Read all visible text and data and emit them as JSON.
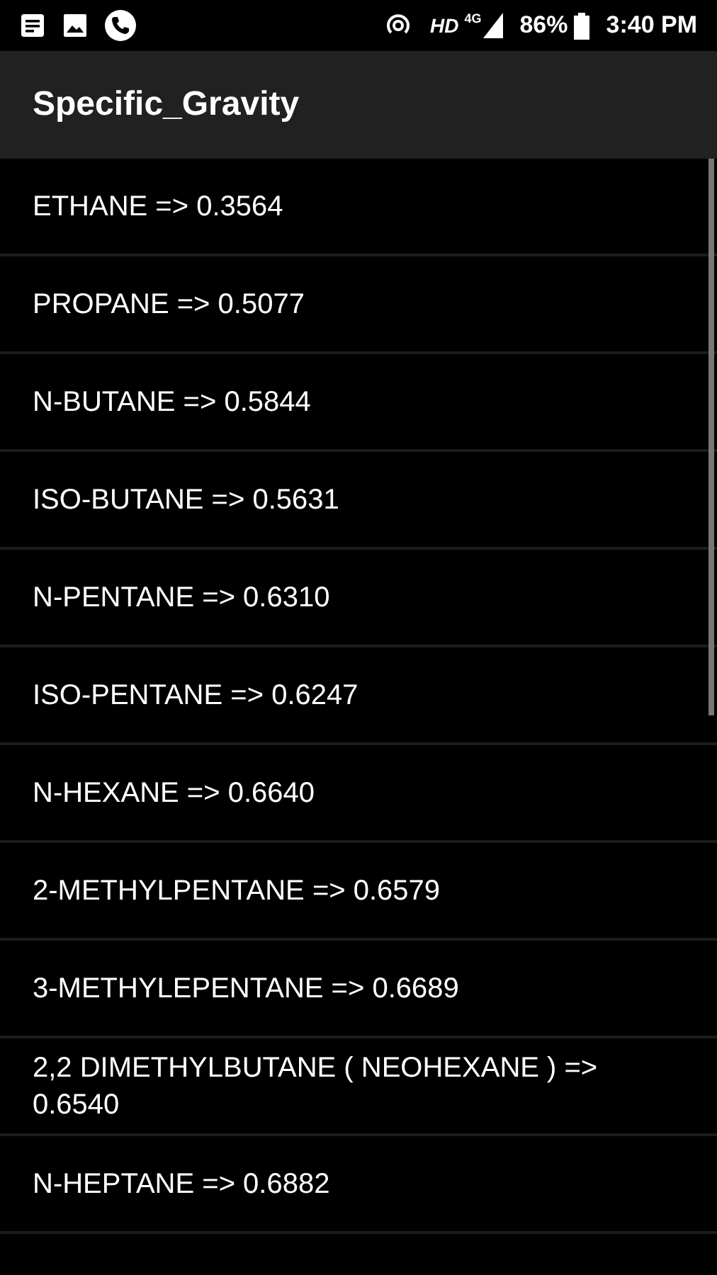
{
  "status_bar": {
    "network": "HD",
    "network_type": "4G",
    "battery": "86%",
    "time": "3:40 PM"
  },
  "app_bar": {
    "title": "Specific_Gravity"
  },
  "items": [
    {
      "text": "ETHANE => 0.3564"
    },
    {
      "text": "PROPANE => 0.5077"
    },
    {
      "text": "N-BUTANE => 0.5844"
    },
    {
      "text": "ISO-BUTANE => 0.5631"
    },
    {
      "text": "N-PENTANE => 0.6310"
    },
    {
      "text": "ISO-PENTANE => 0.6247"
    },
    {
      "text": "N-HEXANE => 0.6640"
    },
    {
      "text": "2-METHYLPENTANE => 0.6579"
    },
    {
      "text": "3-METHYLEPENTANE => 0.6689"
    },
    {
      "text": "2,2 DIMETHYLBUTANE ( NEOHEXANE ) => 0.6540"
    },
    {
      "text": "N-HEPTANE => 0.6882"
    }
  ]
}
